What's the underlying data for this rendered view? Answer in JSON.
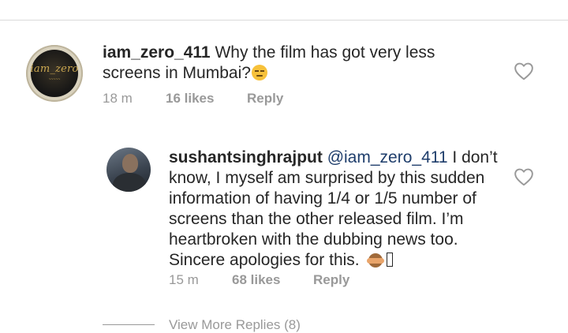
{
  "main_comment": {
    "username": "iam_zero_411",
    "text": "Why the film has got very less screens in Mumbai?",
    "emoji": "unamused-face-emoji",
    "time": "18 m",
    "likes": "16 likes",
    "reply_label": "Reply",
    "avatar_logo_text": "iam_zero"
  },
  "reply_comment": {
    "username": "sushantsinghrajput",
    "mention": "@iam_zero_411",
    "text": "I don’t know, I myself am surprised by this sudden information of having 1/4 or 1/5 number of screens than the other released film. I’m heartbroken with the dubbing news too. Sincere apologies for this.",
    "emoji": "see-no-evil-monkey-emoji",
    "time": "15 m",
    "likes": "68 likes",
    "reply_label": "Reply"
  },
  "view_more": {
    "label": "View More Replies (8)"
  },
  "icons": {
    "like": "heart-outline-icon"
  },
  "colors": {
    "text": "#262626",
    "meta": "#999999",
    "mention": "#1e3d6b",
    "divider": "#dbdbdb"
  }
}
